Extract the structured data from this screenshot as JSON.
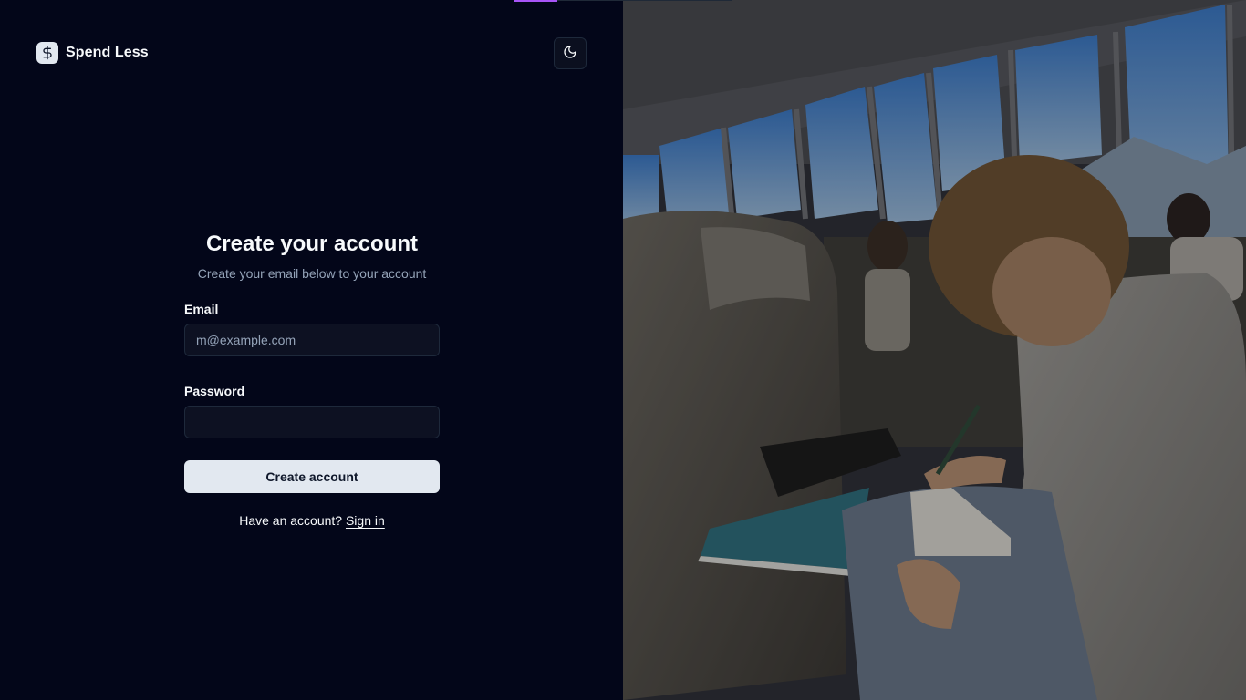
{
  "brand": {
    "name": "Spend Less",
    "icon": "dollar-sign-icon"
  },
  "header": {
    "theme_toggle_icon": "moon-icon"
  },
  "auth": {
    "title": "Create your account",
    "subtitle": "Create your email below to your account",
    "email_label": "Email",
    "email_placeholder": "m@example.com",
    "email_value": "",
    "password_label": "Password",
    "password_value": "",
    "submit_label": "Create account",
    "have_account_text": "Have an account?",
    "signin_link": "Sign in"
  },
  "hero_image": {
    "description_icon": "photo-icon"
  },
  "colors": {
    "background": "#030619",
    "accent_progress": "#a855f7",
    "button_bg": "#e2e8f0",
    "muted_text": "#94a3b8"
  }
}
